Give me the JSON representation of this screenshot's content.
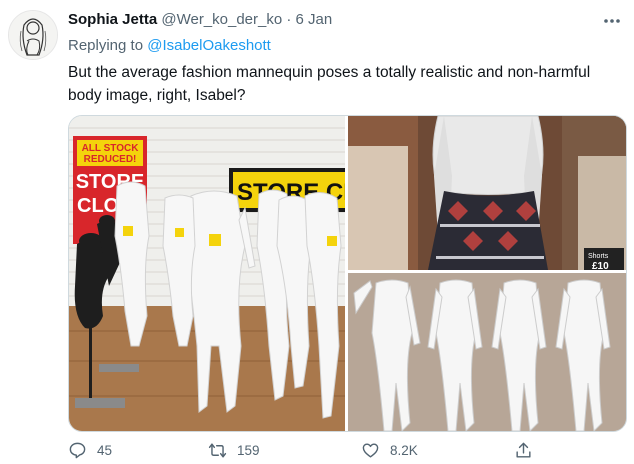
{
  "tweet": {
    "display_name": "Sophia Jetta",
    "handle": "@Wer_ko_der_ko",
    "separator": "·",
    "date": "6 Jan",
    "replying_prefix": "Replying to",
    "replying_to": "@IsabelOakeshott",
    "body": "But the average fashion mannequin poses a totally realistic and non-harmful body image, right, Isabel?"
  },
  "images": {
    "sign1_line1": "ALL STOCK",
    "sign1_line2": "REDUCED!",
    "sign1_line3": "STORE",
    "sign1_line4": "CLO",
    "sign2": "STORE CL",
    "shorts_label": "Shorts",
    "shorts_price": "£10"
  },
  "actions": {
    "replies": "45",
    "retweets": "159",
    "likes": "8.2K"
  },
  "colors": {
    "link": "#1d9bf0",
    "muted": "#536471",
    "text": "#0f1419",
    "sale_red": "#d8262b",
    "sale_yellow": "#f4d30c"
  }
}
